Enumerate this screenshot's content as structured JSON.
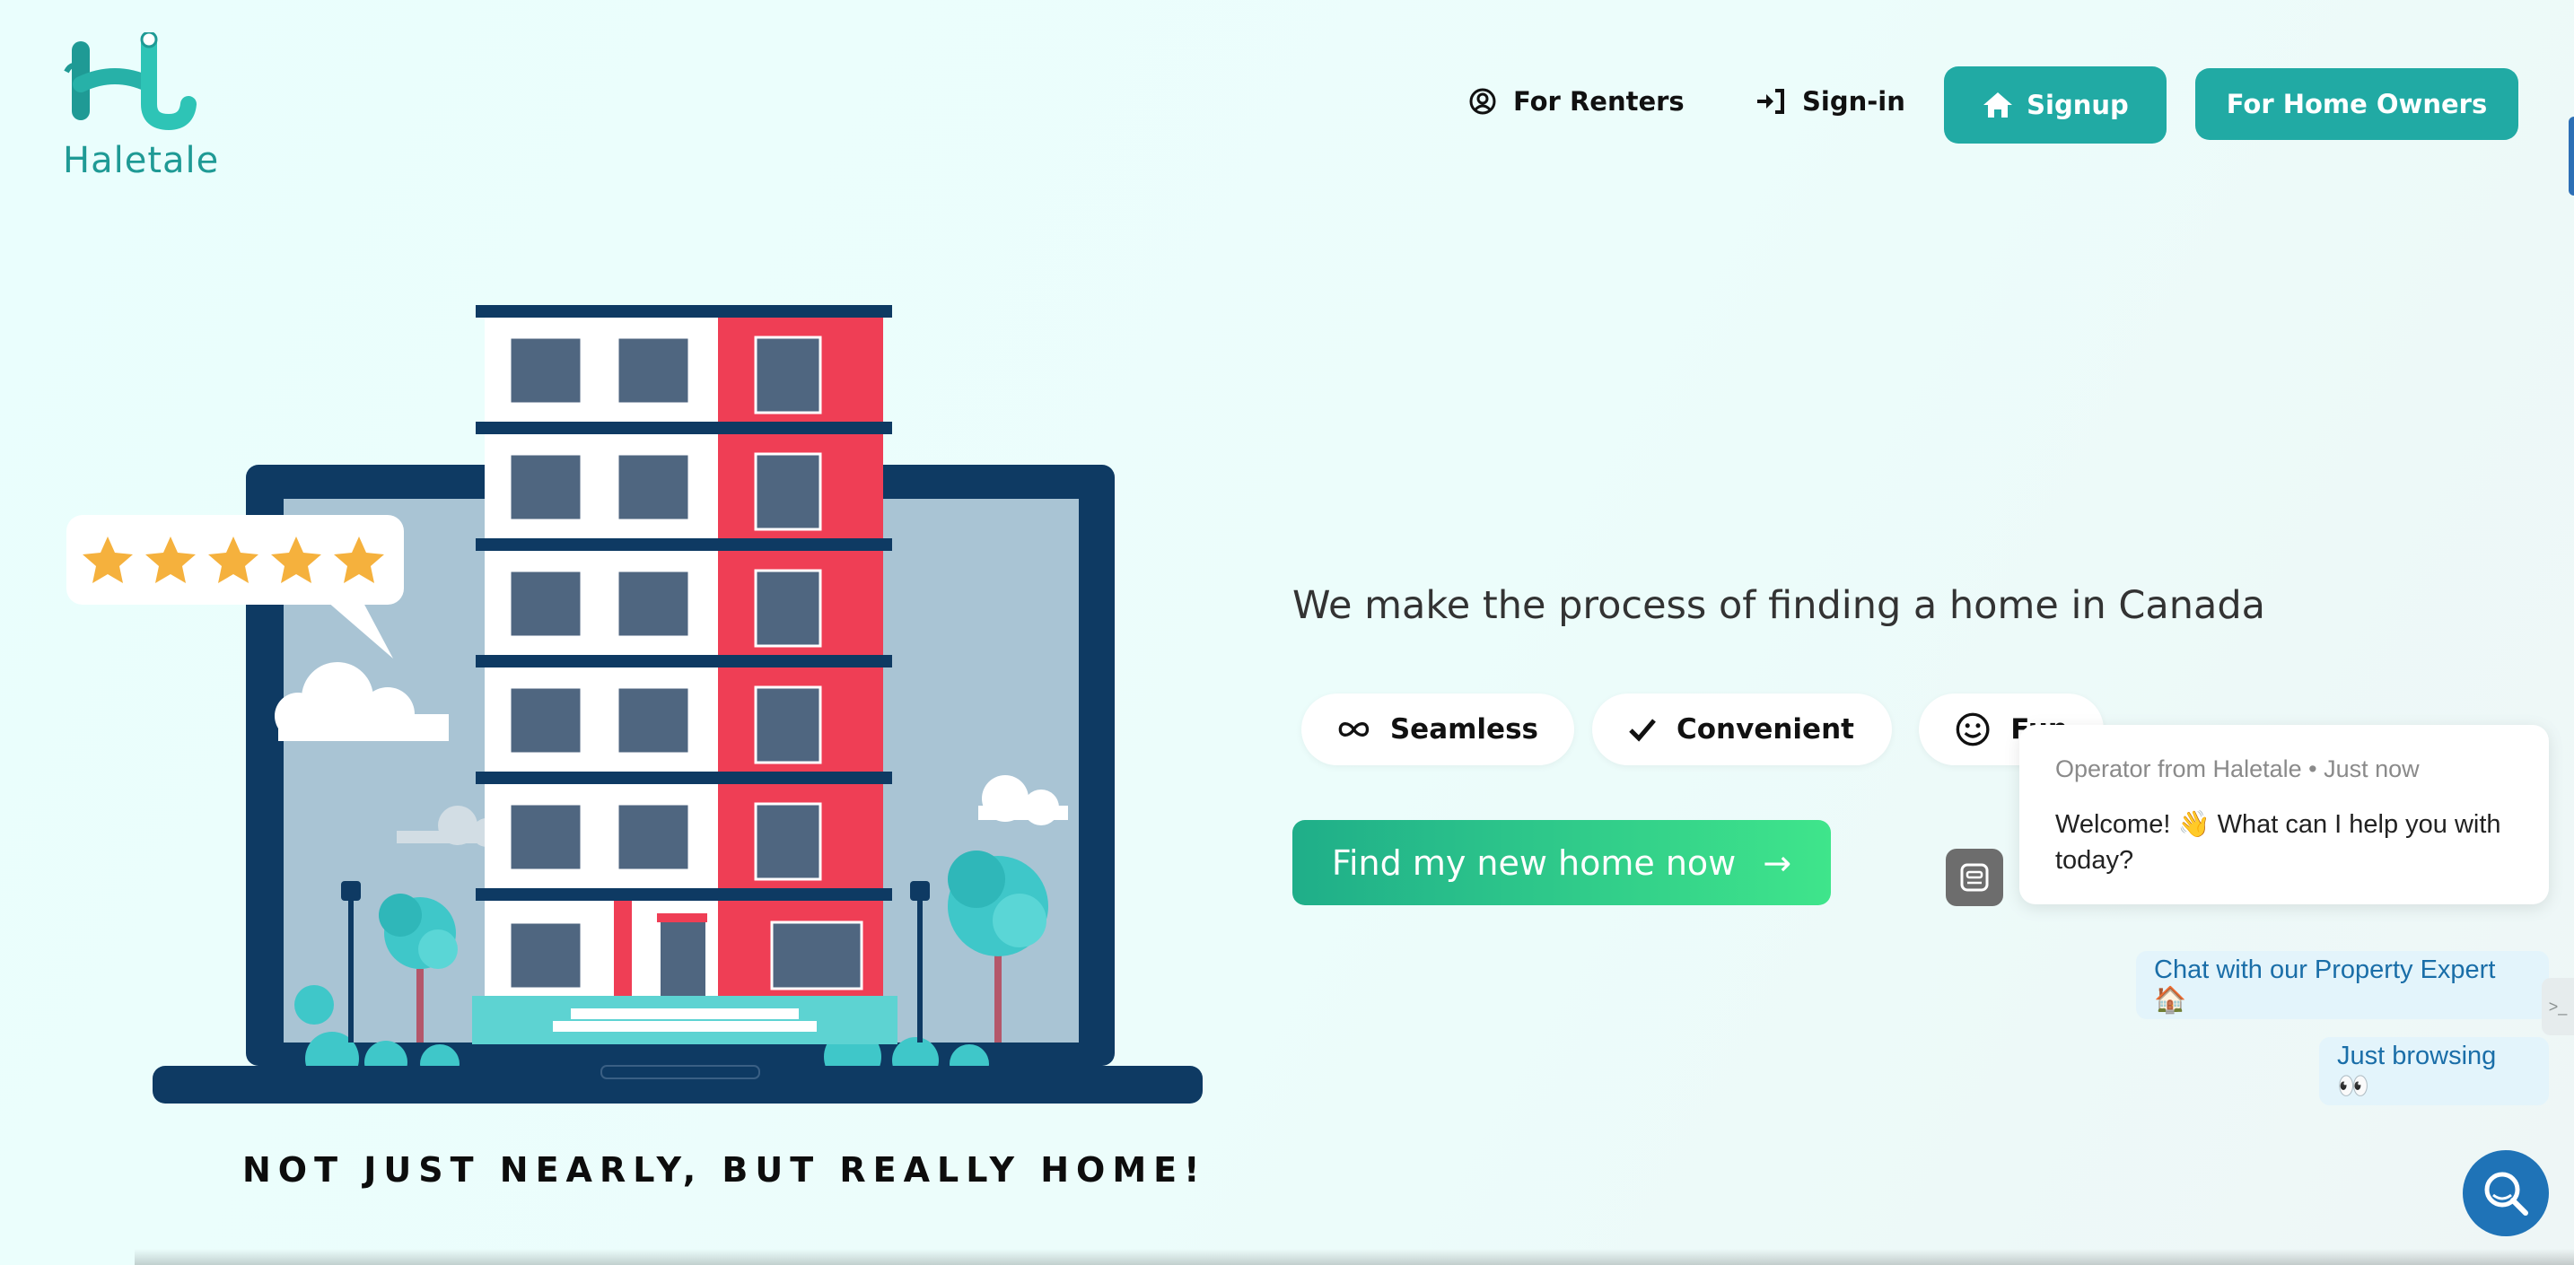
{
  "brand": {
    "name": "Haletale",
    "teal": "#21aaa4"
  },
  "nav": {
    "for_renters": "For Renters",
    "sign_in": "Sign-in",
    "signup": "Signup",
    "for_home_owners": "For Home Owners"
  },
  "hero": {
    "tagline": "NOT JUST NEARLY, BUT REALLY HOME!",
    "rating_stars": 5,
    "headline": "We make the process of finding a home in Canada",
    "features": [
      {
        "label": "Seamless",
        "icon": "infinity-icon"
      },
      {
        "label": "Convenient",
        "icon": "check-icon"
      },
      {
        "label": "Fun",
        "icon": "smiley-icon"
      }
    ],
    "cta": "Find my new home now",
    "cta_arrow": "→"
  },
  "chat": {
    "sender": "Operator from Haletale • Just now",
    "message": "Welcome! 👋 What can I help you with today?",
    "options": [
      "Chat with our Property Expert 🏠",
      "Just browsing 👀"
    ],
    "handle_text": ">_"
  }
}
